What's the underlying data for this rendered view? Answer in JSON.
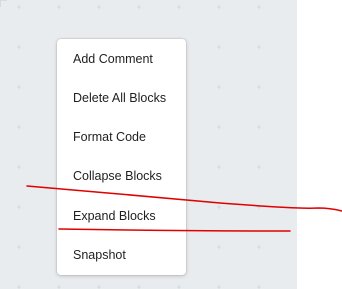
{
  "context_menu": {
    "items": [
      {
        "label": "Add Comment"
      },
      {
        "label": "Delete All Blocks"
      },
      {
        "label": "Format Code"
      },
      {
        "label": "Collapse Blocks"
      },
      {
        "label": "Expand Blocks"
      },
      {
        "label": "Snapshot"
      }
    ]
  },
  "annotation": {
    "stroke_color": "#e00000"
  },
  "workspace": {
    "background_color": "#e9ecef",
    "grid_color": "#d5d9de"
  }
}
